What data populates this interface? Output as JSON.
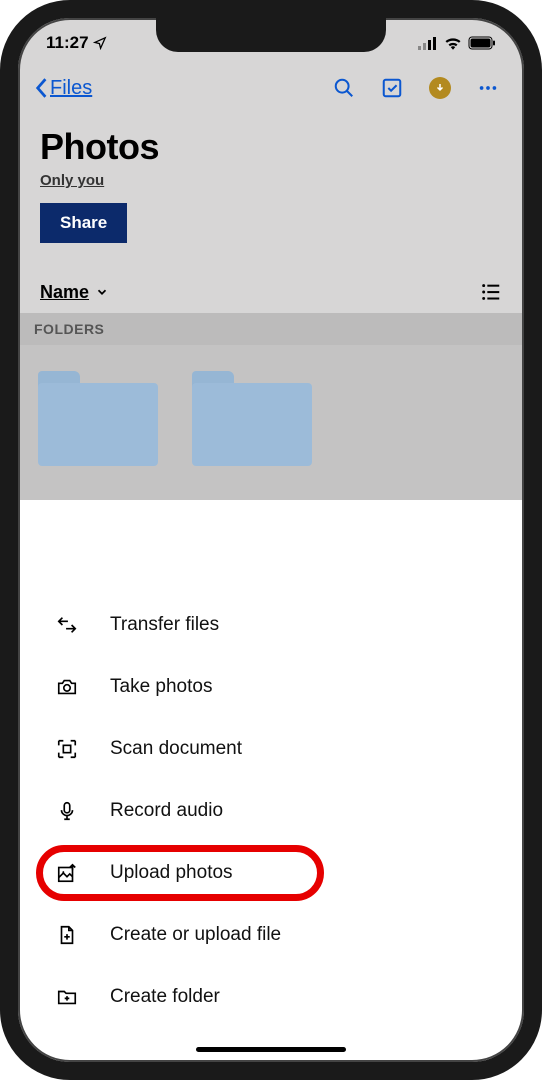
{
  "status": {
    "time": "11:27"
  },
  "nav": {
    "back_label": "Files"
  },
  "header": {
    "title": "Photos",
    "subtitle": "Only you",
    "share_label": "Share"
  },
  "sort": {
    "label": "Name"
  },
  "section": {
    "folders_label": "FOLDERS"
  },
  "menu": {
    "items": [
      {
        "label": "Transfer files"
      },
      {
        "label": "Take photos"
      },
      {
        "label": "Scan document"
      },
      {
        "label": "Record audio"
      },
      {
        "label": "Upload photos"
      },
      {
        "label": "Create or upload file"
      },
      {
        "label": "Create folder"
      }
    ]
  }
}
